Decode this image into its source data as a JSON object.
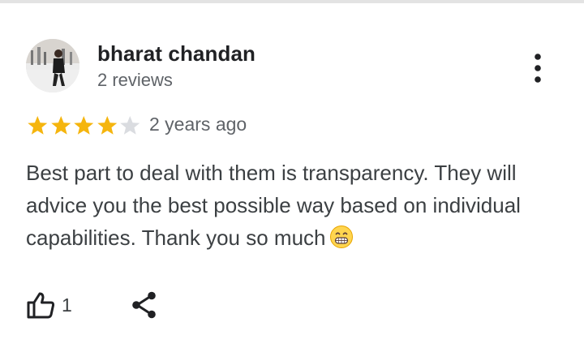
{
  "review": {
    "author_name": "bharat chandan",
    "author_reviews": "2 reviews",
    "rating": 4,
    "rating_max": 5,
    "date": "2 years ago",
    "text": "Best part to deal with them is transparency. They will advice you the best possible way based on individual capabilities. Thank you so much",
    "emoji": "grinning-face-icon",
    "like_count": "1"
  },
  "icons": {
    "more": "more-vert-icon",
    "like": "thumb-up-icon",
    "share": "share-icon"
  },
  "colors": {
    "star_filled": "#F5B50E",
    "star_empty": "#DADCE0",
    "name": "#202124",
    "secondary": "#5F6368",
    "body": "#3C4043"
  }
}
